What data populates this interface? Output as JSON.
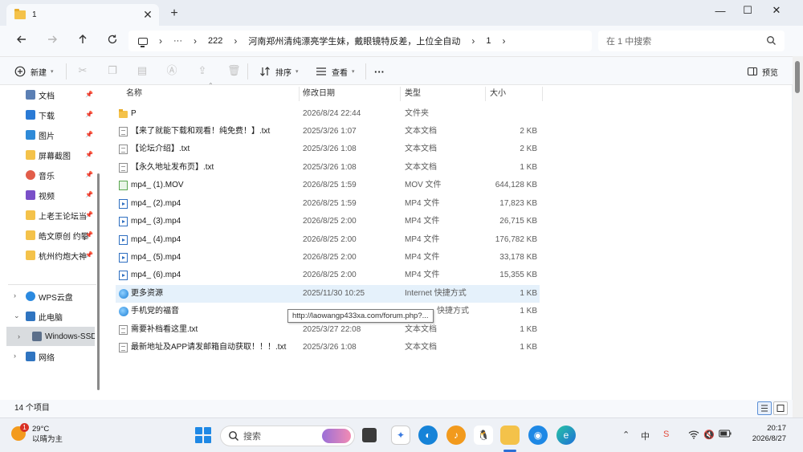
{
  "window": {
    "tab_title": "1",
    "tab_close": "✕",
    "new_tab": "+",
    "minimize": "—",
    "maximize": "☐",
    "close": "✕"
  },
  "address": {
    "more": "···",
    "crumbs": [
      "222",
      "河南郑州清纯漂亮学生妹，戴眼镜特反差，上位全自动",
      "1"
    ],
    "search_placeholder": "在 1 中搜索"
  },
  "toolbar": {
    "new_label": "新建",
    "sort_label": "排序",
    "view_label": "查看",
    "more_label": "···",
    "preview_label": "预览"
  },
  "sidebar": {
    "quick_access": [
      {
        "label": "文档",
        "icon": "document-icon",
        "color": "#5b7fb4"
      },
      {
        "label": "下载",
        "icon": "download-icon",
        "color": "#2a7ad5"
      },
      {
        "label": "图片",
        "icon": "pictures-icon",
        "color": "#2e8ad8"
      },
      {
        "label": "屏幕截图",
        "icon": "folder-icon",
        "color": "#f4c24a"
      },
      {
        "label": "音乐",
        "icon": "music-icon",
        "color": "#e25d4a"
      },
      {
        "label": "视频",
        "icon": "video-icon",
        "color": "#7a4fc8"
      },
      {
        "label": "上老王论坛当",
        "icon": "folder-icon",
        "color": "#f4c24a"
      },
      {
        "label": "皓文原创 约攀",
        "icon": "folder-icon",
        "color": "#f4c24a"
      },
      {
        "label": "杭州约炮大神",
        "icon": "folder-icon",
        "color": "#f4c24a"
      }
    ],
    "pin_glyph": "📌",
    "locations": [
      {
        "label": "WPS云盘",
        "icon": "cloud-icon",
        "color": "#2b8ae0"
      },
      {
        "label": "此电脑",
        "icon": "computer-icon",
        "color": "#2f74c0"
      },
      {
        "label": "Windows-SSD",
        "icon": "drive-icon",
        "color": "#5c6f8a"
      },
      {
        "label": "网络",
        "icon": "network-icon",
        "color": "#2f74c0"
      }
    ]
  },
  "columns": {
    "name": "名称",
    "date": "修改日期",
    "type": "类型",
    "size": "大小"
  },
  "files": [
    {
      "name": "P",
      "date": "2026/8/24 22:44",
      "type": "文件夹",
      "size": "",
      "kind": "folder"
    },
    {
      "name": "【来了就能下载和观看！纯免费！】.txt",
      "date": "2025/3/26 1:07",
      "type": "文本文档",
      "size": "2 KB",
      "kind": "txt"
    },
    {
      "name": "【论坛介绍】.txt",
      "date": "2025/3/26 1:08",
      "type": "文本文档",
      "size": "2 KB",
      "kind": "txt"
    },
    {
      "name": "【永久地址发布页】.txt",
      "date": "2025/3/26 1:08",
      "type": "文本文档",
      "size": "1 KB",
      "kind": "txt"
    },
    {
      "name": "mp4_ (1).MOV",
      "date": "2026/8/25 1:59",
      "type": "MOV 文件",
      "size": "644,128 KB",
      "kind": "mov"
    },
    {
      "name": "mp4_ (2).mp4",
      "date": "2026/8/25 1:59",
      "type": "MP4 文件",
      "size": "17,823 KB",
      "kind": "mp4"
    },
    {
      "name": "mp4_ (3).mp4",
      "date": "2026/8/25 2:00",
      "type": "MP4 文件",
      "size": "26,715 KB",
      "kind": "mp4"
    },
    {
      "name": "mp4_ (4).mp4",
      "date": "2026/8/25 2:00",
      "type": "MP4 文件",
      "size": "176,782 KB",
      "kind": "mp4"
    },
    {
      "name": "mp4_ (5).mp4",
      "date": "2026/8/25 2:00",
      "type": "MP4 文件",
      "size": "33,178 KB",
      "kind": "mp4"
    },
    {
      "name": "mp4_ (6).mp4",
      "date": "2026/8/25 2:00",
      "type": "MP4 文件",
      "size": "15,355 KB",
      "kind": "mp4"
    },
    {
      "name": "更多资源",
      "date": "2025/11/30 10:25",
      "type": "Internet 快捷方式",
      "size": "1 KB",
      "kind": "web"
    },
    {
      "name": "手机党的福音",
      "date": "",
      "type": "快捷方式",
      "size": "1 KB",
      "kind": "web"
    },
    {
      "name": "需要补档看这里.txt",
      "date": "2025/3/27 22:08",
      "type": "文本文档",
      "size": "1 KB",
      "kind": "txt"
    },
    {
      "name": "最新地址及APP请发邮箱自动获取！！！.txt",
      "date": "2025/3/26 1:08",
      "type": "文本文档",
      "size": "1 KB",
      "kind": "txt"
    }
  ],
  "tooltip": "http://laowangp433xa.com/forum.php?...",
  "status": {
    "count": "14 个项目"
  },
  "taskbar": {
    "weather_temp": "29°C",
    "weather_desc": "以晴为主",
    "weather_badge": "1",
    "search_label": "搜索",
    "ime": "中",
    "time": "20:17",
    "date": "2026/8/27"
  }
}
